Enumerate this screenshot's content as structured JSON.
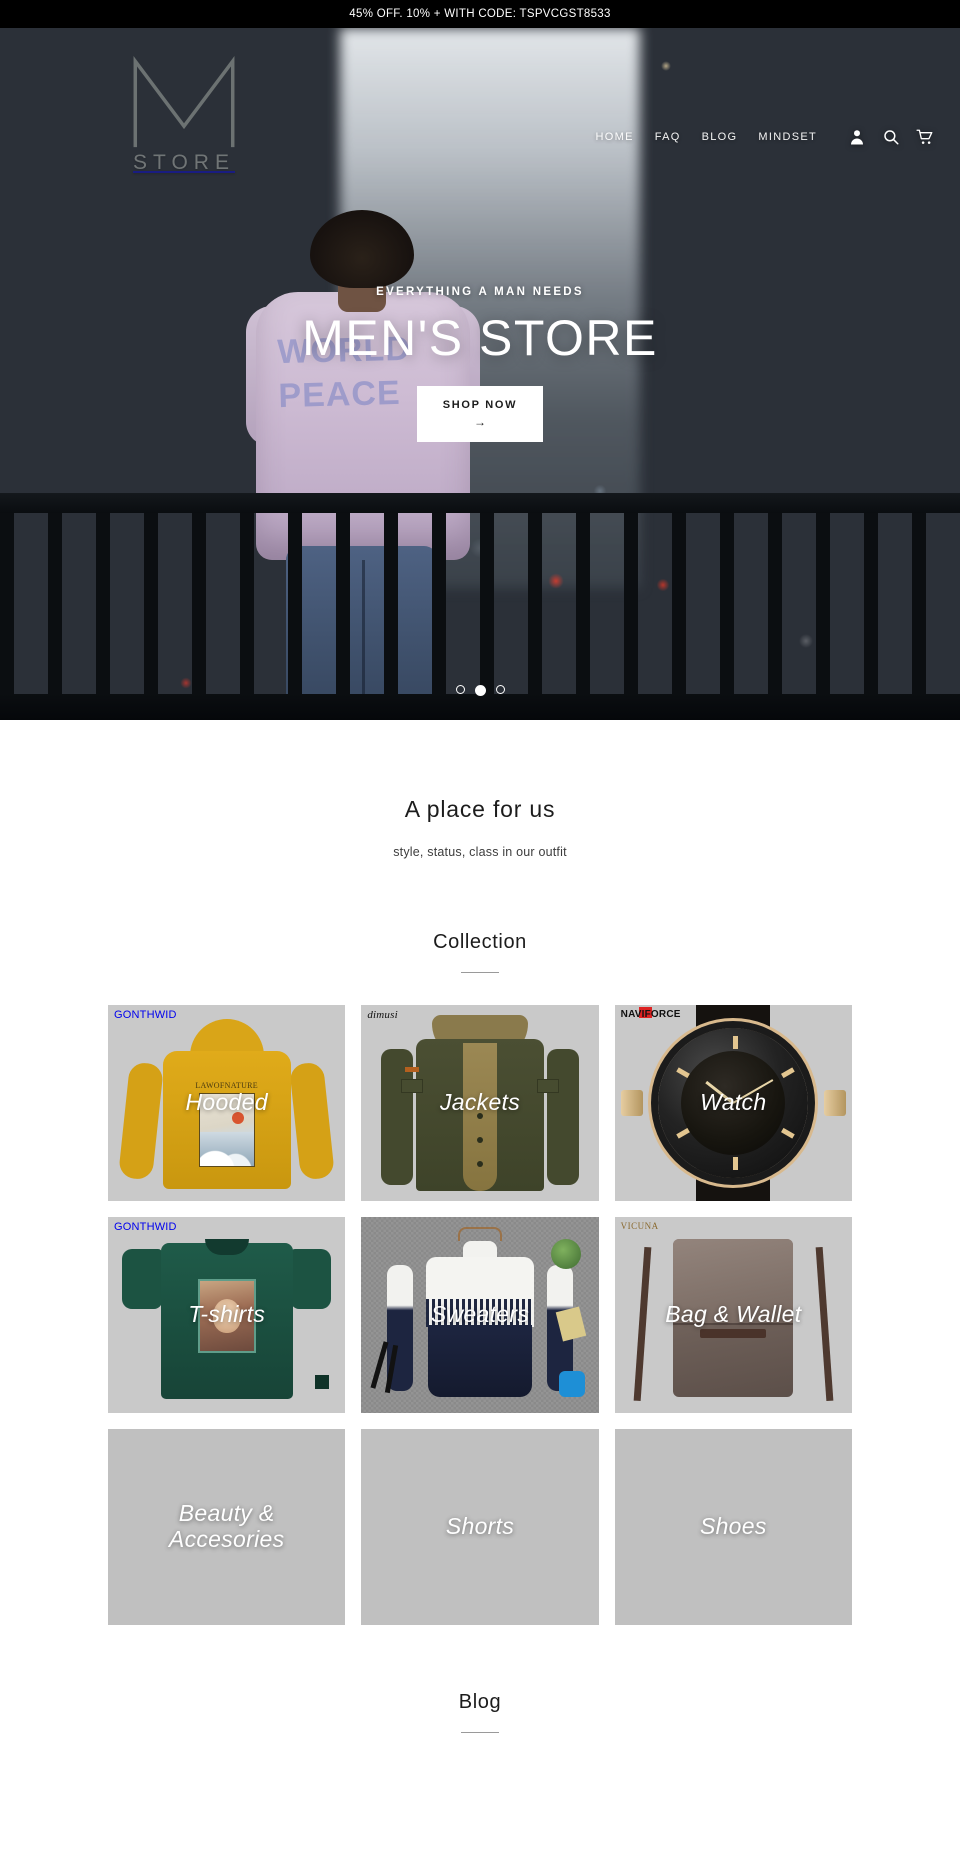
{
  "announcement": {
    "text": "45% OFF. 10% + WITH CODE: TSPVCGST8533"
  },
  "header": {
    "logo": {
      "mark": "M",
      "word": "STORE"
    },
    "nav": [
      {
        "label": "HOME"
      },
      {
        "label": "FAQ"
      },
      {
        "label": "BLOG"
      },
      {
        "label": "MINDSET"
      }
    ],
    "icons": [
      {
        "name": "account-icon"
      },
      {
        "name": "search-icon"
      },
      {
        "name": "cart-icon"
      }
    ]
  },
  "hero": {
    "eyebrow": "EVERYTHING A MAN NEEDS",
    "title": "MEN'S STORE",
    "cta_label": "SHOP NOW",
    "cta_arrow": "→",
    "shirt_print": "WORLD\nPEACE",
    "slides": [
      {
        "index": 1,
        "active": false
      },
      {
        "index": 2,
        "active": true
      },
      {
        "index": 3,
        "active": false
      }
    ]
  },
  "intro": {
    "title": "A place for us",
    "subtitle": "style, status, class in our outfit"
  },
  "collection": {
    "title": "Collection",
    "tiles": [
      {
        "label": "Hooded",
        "brand": "GONTHWID",
        "brand_style": "block",
        "art": "hoodie",
        "has_image": true
      },
      {
        "label": "Jackets",
        "brand": "dimusi",
        "brand_style": "script",
        "art": "jacket",
        "has_image": true
      },
      {
        "label": "Watch",
        "brand": "NAVIFORCE",
        "brand_style": "nav",
        "art": "watch",
        "has_image": true
      },
      {
        "label": "T-shirts",
        "brand": "GONTHWID",
        "brand_style": "block",
        "art": "tshirt",
        "has_image": true
      },
      {
        "label": "Sweaters",
        "brand": "",
        "brand_style": "none",
        "art": "sweater",
        "has_image": true
      },
      {
        "label": "Bag & Wallet",
        "brand": "VICUNA",
        "brand_style": "vicuna",
        "art": "bag",
        "has_image": true
      },
      {
        "label": "Beauty &\nAccesories",
        "brand": "",
        "brand_style": "none",
        "art": "placeholder",
        "has_image": false
      },
      {
        "label": "Shorts",
        "brand": "",
        "brand_style": "none",
        "art": "placeholder",
        "has_image": false
      },
      {
        "label": "Shoes",
        "brand": "",
        "brand_style": "none",
        "art": "placeholder",
        "has_image": false
      }
    ]
  },
  "blog": {
    "title": "Blog"
  },
  "colors": {
    "announcement_bg": "#000000",
    "announcement_text": "#ffffff",
    "page_bg": "#ffffff",
    "text": "#1c1c1c",
    "tile_placeholder": "#c0c0c0",
    "cta_bg": "#ffffff",
    "cta_text": "#1c1c1c"
  }
}
